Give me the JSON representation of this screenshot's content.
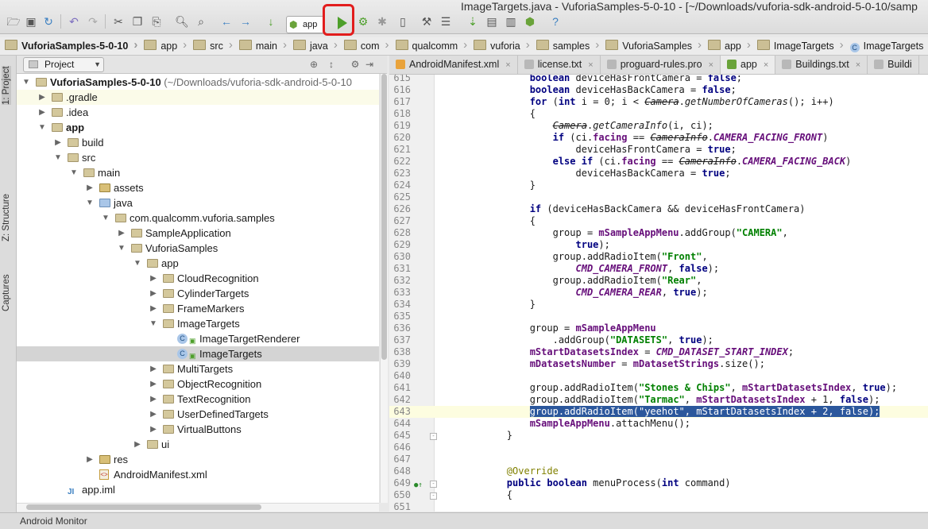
{
  "window": {
    "title": "ImageTargets.java - VuforiaSamples-5-0-10 - [~/Downloads/vuforia-sdk-android-5-0-10/samp"
  },
  "toolbar": {
    "run_config": "app"
  },
  "breadcrumb": [
    "VuforiaSamples-5-0-10",
    "app",
    "src",
    "main",
    "java",
    "com",
    "qualcomm",
    "vuforia",
    "samples",
    "VuforiaSamples",
    "app",
    "ImageTargets",
    "ImageTargets"
  ],
  "left_tabs": [
    "1: Project",
    "Z: Structure",
    "Captures"
  ],
  "project_panel": {
    "view_selector": "Project"
  },
  "tree": [
    {
      "label": "VuforiaSamples-5-0-10",
      "detail": " (~/Downloads/vuforia-sdk-android-5-0-10",
      "depth": 0,
      "arrow": "down",
      "icon": "module",
      "bold": true
    },
    {
      "label": ".gradle",
      "depth": 1,
      "arrow": "right",
      "icon": "folder",
      "highlight": true
    },
    {
      "label": ".idea",
      "depth": 1,
      "arrow": "right",
      "icon": "folder"
    },
    {
      "label": "app",
      "depth": 1,
      "arrow": "down",
      "icon": "module",
      "bold": true
    },
    {
      "label": "build",
      "depth": 2,
      "arrow": "right",
      "icon": "folder"
    },
    {
      "label": "src",
      "depth": 2,
      "arrow": "down",
      "icon": "folder"
    },
    {
      "label": "main",
      "depth": 3,
      "arrow": "down",
      "icon": "folder"
    },
    {
      "label": "assets",
      "depth": 4,
      "arrow": "right",
      "icon": "res"
    },
    {
      "label": "java",
      "depth": 4,
      "arrow": "down",
      "icon": "src"
    },
    {
      "label": "com.qualcomm.vuforia.samples",
      "depth": 5,
      "arrow": "down",
      "icon": "folder"
    },
    {
      "label": "SampleApplication",
      "depth": 6,
      "arrow": "right",
      "icon": "folder"
    },
    {
      "label": "VuforiaSamples",
      "depth": 6,
      "arrow": "down",
      "icon": "folder"
    },
    {
      "label": "app",
      "depth": 7,
      "arrow": "down",
      "icon": "folder"
    },
    {
      "label": "CloudRecognition",
      "depth": 8,
      "arrow": "right",
      "icon": "folder"
    },
    {
      "label": "CylinderTargets",
      "depth": 8,
      "arrow": "right",
      "icon": "folder"
    },
    {
      "label": "FrameMarkers",
      "depth": 8,
      "arrow": "right",
      "icon": "folder"
    },
    {
      "label": "ImageTargets",
      "depth": 8,
      "arrow": "down",
      "icon": "folder"
    },
    {
      "label": "ImageTargetRenderer",
      "depth": 9,
      "arrow": "",
      "icon": "class"
    },
    {
      "label": "ImageTargets",
      "depth": 9,
      "arrow": "",
      "icon": "class",
      "selected": true
    },
    {
      "label": "MultiTargets",
      "depth": 8,
      "arrow": "right",
      "icon": "folder"
    },
    {
      "label": "ObjectRecognition",
      "depth": 8,
      "arrow": "right",
      "icon": "folder"
    },
    {
      "label": "TextRecognition",
      "depth": 8,
      "arrow": "right",
      "icon": "folder"
    },
    {
      "label": "UserDefinedTargets",
      "depth": 8,
      "arrow": "right",
      "icon": "folder"
    },
    {
      "label": "VirtualButtons",
      "depth": 8,
      "arrow": "right",
      "icon": "folder"
    },
    {
      "label": "ui",
      "depth": 7,
      "arrow": "right",
      "icon": "folder"
    },
    {
      "label": "res",
      "depth": 4,
      "arrow": "right",
      "icon": "res"
    },
    {
      "label": "AndroidManifest.xml",
      "depth": 4,
      "arrow": "",
      "icon": "xml"
    },
    {
      "label": "app.iml",
      "depth": 2,
      "arrow": "",
      "icon": "iml"
    }
  ],
  "editor_tabs": [
    {
      "label": "AndroidManifest.xml",
      "color": "#e9a33b"
    },
    {
      "label": "license.txt",
      "color": "#b8b8b8"
    },
    {
      "label": "proguard-rules.pro",
      "color": "#b8b8b8"
    },
    {
      "label": "app",
      "color": "#6aa33a",
      "active": true
    },
    {
      "label": "Buildings.txt",
      "color": "#b8b8b8"
    },
    {
      "label": "Buildi",
      "color": "#b8b8b8"
    }
  ],
  "code": [
    {
      "n": "615",
      "t": "            <k>boolean</k> deviceHasFrontCamera = <k>false</k>;"
    },
    {
      "n": "616",
      "t": "            <k>boolean</k> deviceHasBackCamera = <k>false</k>;"
    },
    {
      "n": "617",
      "t": "            <k>for</k> (<k>int</k> i = 0; i < <st>Camera</st>.<it>getNumberOfCameras</it>(); i++)"
    },
    {
      "n": "618",
      "t": "            {"
    },
    {
      "n": "619",
      "t": "                <st>Camera</st>.<it>getCameraInfo</it>(i, ci);"
    },
    {
      "n": "620",
      "t": "                <k>if</k> (ci.<f>facing</f> == <st>CameraInfo</st>.<fi>CAMERA_FACING_FRONT</fi>)"
    },
    {
      "n": "621",
      "t": "                    deviceHasFrontCamera = <k>true</k>;"
    },
    {
      "n": "622",
      "t": "                <k>else if</k> (ci.<f>facing</f> == <st>CameraInfo</st>.<fi>CAMERA_FACING_BACK</fi>)"
    },
    {
      "n": "623",
      "t": "                    deviceHasBackCamera = <k>true</k>;"
    },
    {
      "n": "624",
      "t": "            }"
    },
    {
      "n": "625",
      "t": ""
    },
    {
      "n": "626",
      "t": "            <k>if</k> (deviceHasBackCamera && deviceHasFrontCamera)"
    },
    {
      "n": "627",
      "t": "            {"
    },
    {
      "n": "628",
      "t": "                group = <f>mSampleAppMenu</f>.addGroup(<s>\"CAMERA\"</s>,"
    },
    {
      "n": "629",
      "t": "                    <k>true</k>);"
    },
    {
      "n": "630",
      "t": "                group.addRadioItem(<s>\"Front\"</s>,"
    },
    {
      "n": "631",
      "t": "                    <fi>CMD_CAMERA_FRONT</fi>, <k>false</k>);"
    },
    {
      "n": "632",
      "t": "                group.addRadioItem(<s>\"Rear\"</s>,"
    },
    {
      "n": "633",
      "t": "                    <fi>CMD_CAMERA_REAR</fi>, <k>true</k>);"
    },
    {
      "n": "634",
      "t": "            }"
    },
    {
      "n": "635",
      "t": ""
    },
    {
      "n": "636",
      "t": "            group = <f>mSampleAppMenu</f>"
    },
    {
      "n": "637",
      "t": "                .addGroup(<s>\"DATASETS\"</s>, <k>true</k>);"
    },
    {
      "n": "638",
      "t": "            <f>mStartDatasetsIndex</f> = <fi>CMD_DATASET_START_INDEX</fi>;"
    },
    {
      "n": "639",
      "t": "            <f>mDatasetsNumber</f> = <f>mDatasetStrings</f>.size();"
    },
    {
      "n": "640",
      "t": ""
    },
    {
      "n": "641",
      "t": "            group.addRadioItem(<s>\"Stones & Chips\"</s>, <f>mStartDatasetsIndex</f>, <k>true</k>);"
    },
    {
      "n": "642",
      "t": "            group.addRadioItem(<s>\"Tarmac\"</s>, <f>mStartDatasetsIndex</f> + 1, <k>false</k>);"
    },
    {
      "n": "643",
      "t": "            group.addRadioItem(\"yeehot\", mStartDatasetsIndex + 2, false);",
      "selected": true
    },
    {
      "n": "644",
      "t": "            <f>mSampleAppMenu</f>.attachMenu();"
    },
    {
      "n": "645",
      "t": "        }",
      "fold": true
    },
    {
      "n": "646",
      "t": ""
    },
    {
      "n": "647",
      "t": ""
    },
    {
      "n": "648",
      "t": "        <an>@Override</an>"
    },
    {
      "n": "649",
      "t": "        <k>public boolean</k> menuProcess(<k>int</k> command)",
      "marker": true,
      "fold": true
    },
    {
      "n": "650",
      "t": "        {",
      "fold": true
    },
    {
      "n": "651",
      "t": ""
    }
  ],
  "status": {
    "label": "Android Monitor"
  }
}
